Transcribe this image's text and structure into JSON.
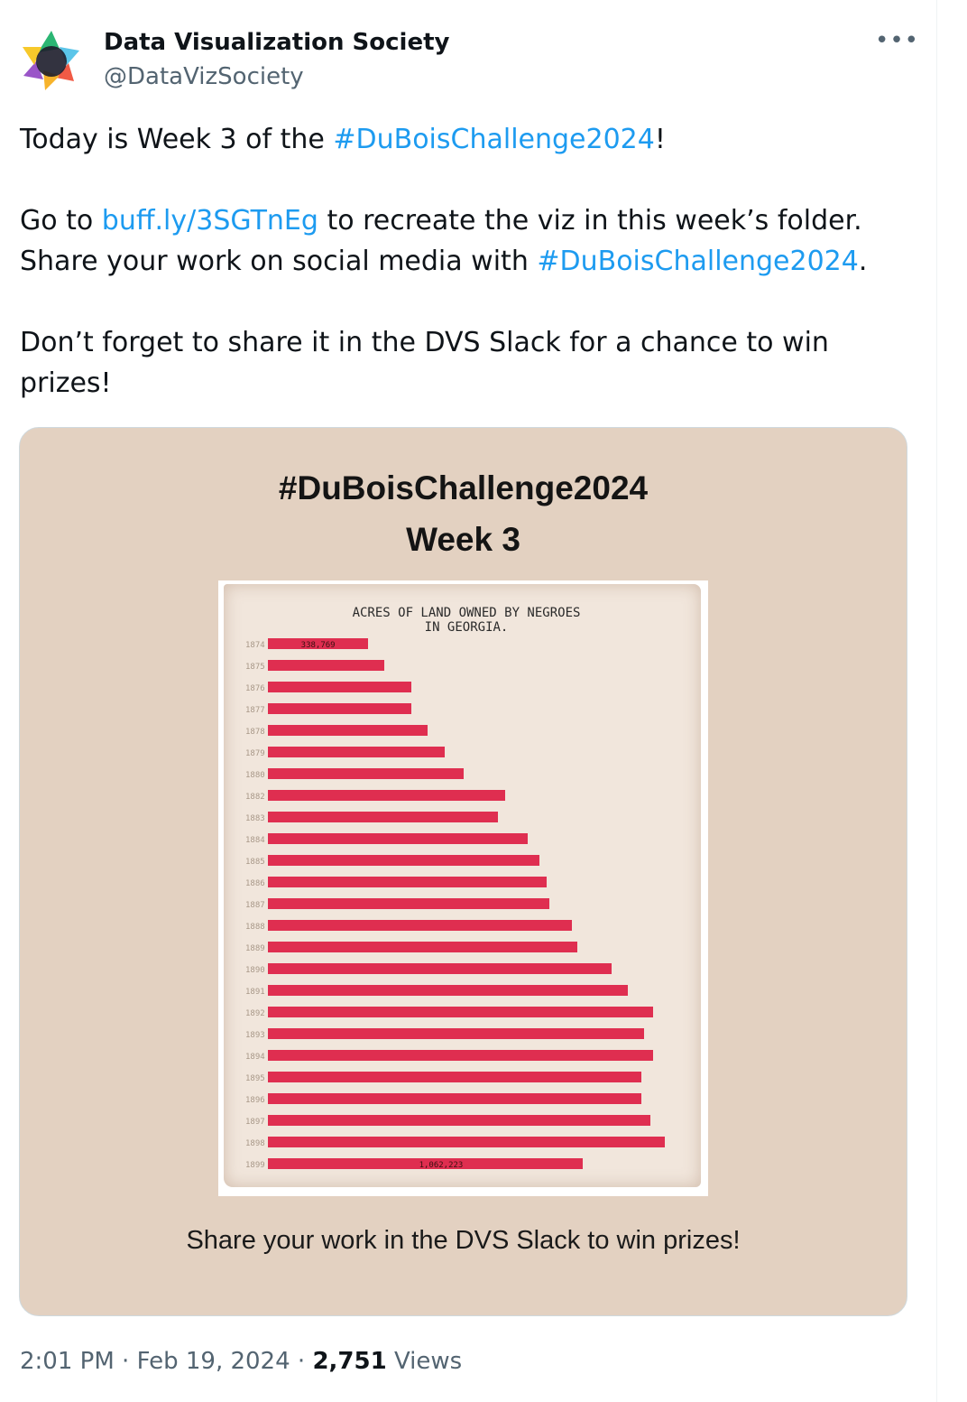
{
  "account": {
    "name": "Data Visualization Society",
    "handle": "@DataVizSociety",
    "avatar_icon": "dvs-star-logo-icon",
    "more_icon": "more-options-icon"
  },
  "tweet": {
    "line1_prefix": "Today is Week 3 of the ",
    "line1_hashtag": "#DuBoisChallenge2024",
    "line1_suffix": "!",
    "line2_prefix": "Go to ",
    "line2_link": "buff.ly/3SGTnEg",
    "line2_suffix": " to recreate the viz in this week’s folder.",
    "line3_prefix": "Share your work on social media with ",
    "line3_hashtag": "#DuBoisChallenge2024",
    "line3_suffix": ".",
    "line4": "Don’t forget to share it in the DVS Slack for a chance to win prizes!"
  },
  "media": {
    "title_line1": "#DuBoisChallenge2024",
    "title_line2": "Week 3",
    "caption": "Share your work in the DVS Slack to win prizes!"
  },
  "footer": {
    "time": "2:01 PM",
    "separator": "·",
    "date": "Feb 19, 2024",
    "views_count": "2,751",
    "views_label": "Views"
  },
  "colors": {
    "link": "#1d9bf0",
    "muted": "#536471",
    "media_bg": "#e3d1c1",
    "paper": "#f1e6dc",
    "bar_red": "#dc143c"
  },
  "chart_data": {
    "type": "bar",
    "orientation": "horizontal",
    "title": "ACRES OF LAND OWNED BY NEGROES IN GEORGIA.",
    "title_lines": [
      "ACRES OF LAND OWNED BY NEGROES",
      "IN GEORGIA."
    ],
    "categories": [
      "1874",
      "1875",
      "1876",
      "1877",
      "1878",
      "1879",
      "1880",
      "1882",
      "1883",
      "1884",
      "1885",
      "1886",
      "1887",
      "1888",
      "1889",
      "1890",
      "1891",
      "1892",
      "1893",
      "1894",
      "1895",
      "1896",
      "1897",
      "1898",
      "1899"
    ],
    "values": [
      338769,
      394000,
      483000,
      483000,
      540000,
      596000,
      660000,
      800000,
      775000,
      875000,
      915000,
      940000,
      950000,
      1025000,
      1045000,
      1160000,
      1215000,
      1300000,
      1270000,
      1300000,
      1260000,
      1260000,
      1290000,
      1340000,
      1062223
    ],
    "data_labels": [
      {
        "category": "1874",
        "text": "338,769"
      },
      {
        "category": "1899",
        "text": "1,062,223"
      }
    ],
    "xlim": [
      0,
      1400000
    ],
    "grid": false,
    "legend": "none"
  }
}
